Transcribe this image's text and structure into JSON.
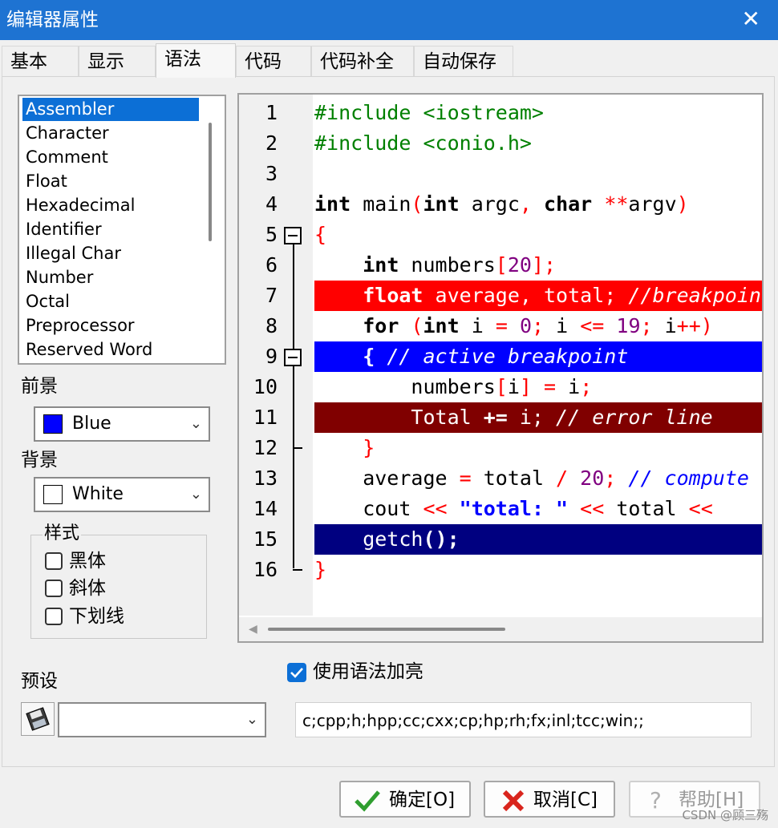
{
  "window": {
    "title": "编辑器属性",
    "close_glyph": "✕"
  },
  "tabs": [
    {
      "label": "基本"
    },
    {
      "label": "显示"
    },
    {
      "label": "语法",
      "active": true
    },
    {
      "label": "代码"
    },
    {
      "label": "代码补全"
    },
    {
      "label": "自动保存"
    }
  ],
  "syntax_list": {
    "selected": "Assembler",
    "items": [
      "Assembler",
      "Character",
      "Comment",
      "Float",
      "Hexadecimal",
      "Identifier",
      "Illegal Char",
      "Number",
      "Octal",
      "Preprocessor",
      "Reserved Word"
    ]
  },
  "foreground": {
    "label": "前景",
    "value": "Blue",
    "color": "#0000ff"
  },
  "background": {
    "label": "背景",
    "value": "White",
    "color": "#ffffff"
  },
  "style_group": {
    "title": "样式",
    "options": [
      {
        "label": "黑体",
        "checked": false
      },
      {
        "label": "斜体",
        "checked": false
      },
      {
        "label": "下划线",
        "checked": false
      }
    ]
  },
  "preview": {
    "line_numbers": [
      "1",
      "2",
      "3",
      "4",
      "5",
      "6",
      "7",
      "8",
      "9",
      "10",
      "11",
      "12",
      "13",
      "14",
      "15",
      "16"
    ],
    "lines": [
      {
        "bg": "",
        "tokens": [
          {
            "t": "#include <iostream>",
            "c": "#008000"
          }
        ]
      },
      {
        "bg": "",
        "tokens": [
          {
            "t": "#include <conio.h>",
            "c": "#008000"
          }
        ]
      },
      {
        "bg": "",
        "tokens": []
      },
      {
        "bg": "",
        "tokens": [
          {
            "t": "int",
            "c": "#000000",
            "b": true
          },
          {
            "t": " main",
            "c": "#000000"
          },
          {
            "t": "(",
            "c": "#ff0000"
          },
          {
            "t": "int",
            "c": "#000000",
            "b": true
          },
          {
            "t": " argc",
            "c": "#000000"
          },
          {
            "t": ",",
            "c": "#ff0000"
          },
          {
            "t": " ",
            "c": "#000000"
          },
          {
            "t": "char",
            "c": "#000000",
            "b": true
          },
          {
            "t": " ",
            "c": "#000000"
          },
          {
            "t": "**",
            "c": "#ff0000"
          },
          {
            "t": "argv",
            "c": "#000000"
          },
          {
            "t": ")",
            "c": "#ff0000"
          }
        ]
      },
      {
        "bg": "",
        "tokens": [
          {
            "t": "{",
            "c": "#ff0000"
          }
        ]
      },
      {
        "bg": "",
        "tokens": [
          {
            "t": "    ",
            "c": "#000000"
          },
          {
            "t": "int",
            "c": "#000000",
            "b": true
          },
          {
            "t": " numbers",
            "c": "#000000"
          },
          {
            "t": "[",
            "c": "#ff0000"
          },
          {
            "t": "20",
            "c": "#800080"
          },
          {
            "t": "];",
            "c": "#ff0000"
          }
        ]
      },
      {
        "bg": "#ff0000",
        "tokens": [
          {
            "t": "    ",
            "c": "#ffffff"
          },
          {
            "t": "float",
            "c": "#ffffff",
            "b": true
          },
          {
            "t": " average, total; ",
            "c": "#ffffff"
          },
          {
            "t": "//breakpoint",
            "c": "#ffffff",
            "i": true
          }
        ]
      },
      {
        "bg": "",
        "tokens": [
          {
            "t": "    ",
            "c": "#000000"
          },
          {
            "t": "for",
            "c": "#000000",
            "b": true
          },
          {
            "t": " ",
            "c": "#000000"
          },
          {
            "t": "(",
            "c": "#ff0000"
          },
          {
            "t": "int",
            "c": "#000000",
            "b": true
          },
          {
            "t": " i ",
            "c": "#000000"
          },
          {
            "t": "=",
            "c": "#ff0000"
          },
          {
            "t": " ",
            "c": "#000000"
          },
          {
            "t": "0",
            "c": "#800080"
          },
          {
            "t": ";",
            "c": "#ff0000"
          },
          {
            "t": " i ",
            "c": "#000000"
          },
          {
            "t": "<=",
            "c": "#ff0000"
          },
          {
            "t": " ",
            "c": "#000000"
          },
          {
            "t": "19",
            "c": "#800080"
          },
          {
            "t": ";",
            "c": "#ff0000"
          },
          {
            "t": " i",
            "c": "#000000"
          },
          {
            "t": "++)",
            "c": "#ff0000"
          }
        ]
      },
      {
        "bg": "#0000ff",
        "tokens": [
          {
            "t": "    ",
            "c": "#ffffff"
          },
          {
            "t": "{",
            "c": "#ffffff",
            "b": true
          },
          {
            "t": " ",
            "c": "#ffffff"
          },
          {
            "t": "// active breakpoint",
            "c": "#ffffff",
            "i": true
          }
        ]
      },
      {
        "bg": "",
        "tokens": [
          {
            "t": "        numbers",
            "c": "#000000"
          },
          {
            "t": "[",
            "c": "#ff0000"
          },
          {
            "t": "i",
            "c": "#000000"
          },
          {
            "t": "]",
            "c": "#ff0000"
          },
          {
            "t": " ",
            "c": "#000000"
          },
          {
            "t": "=",
            "c": "#ff0000"
          },
          {
            "t": " i",
            "c": "#000000"
          },
          {
            "t": ";",
            "c": "#ff0000"
          }
        ]
      },
      {
        "bg": "#800000",
        "tokens": [
          {
            "t": "        Total ",
            "c": "#ffffff"
          },
          {
            "t": "+=",
            "c": "#ffffff",
            "b": true
          },
          {
            "t": " i; ",
            "c": "#ffffff"
          },
          {
            "t": "// error line",
            "c": "#ffffff",
            "i": true
          }
        ]
      },
      {
        "bg": "",
        "tokens": [
          {
            "t": "    ",
            "c": "#000000"
          },
          {
            "t": "}",
            "c": "#ff0000"
          }
        ]
      },
      {
        "bg": "",
        "tokens": [
          {
            "t": "    average ",
            "c": "#000000"
          },
          {
            "t": "=",
            "c": "#ff0000"
          },
          {
            "t": " total ",
            "c": "#000000"
          },
          {
            "t": "/",
            "c": "#ff0000"
          },
          {
            "t": " ",
            "c": "#000000"
          },
          {
            "t": "20",
            "c": "#800080"
          },
          {
            "t": ";",
            "c": "#ff0000"
          },
          {
            "t": " ",
            "c": "#000000"
          },
          {
            "t": "// compute",
            "c": "#0000ff",
            "i": true
          }
        ]
      },
      {
        "bg": "",
        "tokens": [
          {
            "t": "    cout ",
            "c": "#000000"
          },
          {
            "t": "<<",
            "c": "#ff0000"
          },
          {
            "t": " ",
            "c": "#000000"
          },
          {
            "t": "\"total: \"",
            "c": "#0000ff",
            "b": true
          },
          {
            "t": " ",
            "c": "#000000"
          },
          {
            "t": "<<",
            "c": "#ff0000"
          },
          {
            "t": " total ",
            "c": "#000000"
          },
          {
            "t": "<<",
            "c": "#ff0000"
          }
        ]
      },
      {
        "bg": "#000080",
        "tokens": [
          {
            "t": "    getch",
            "c": "#ffffff"
          },
          {
            "t": "();",
            "c": "#ffffff",
            "b": true
          }
        ]
      },
      {
        "bg": "",
        "tokens": [
          {
            "t": "}",
            "c": "#ff0000"
          }
        ]
      }
    ]
  },
  "preset": {
    "label": "预设",
    "value": ""
  },
  "use_highlight": {
    "label": "使用语法加亮",
    "checked": true
  },
  "extensions": "c;cpp;h;hpp;cc;cxx;cp;hp;rh;fx;inl;tcc;win;;",
  "buttons": {
    "ok": "确定[O]",
    "cancel": "取消[C]",
    "help": "帮助[H]"
  },
  "watermark": "CSDN @顾三殇"
}
